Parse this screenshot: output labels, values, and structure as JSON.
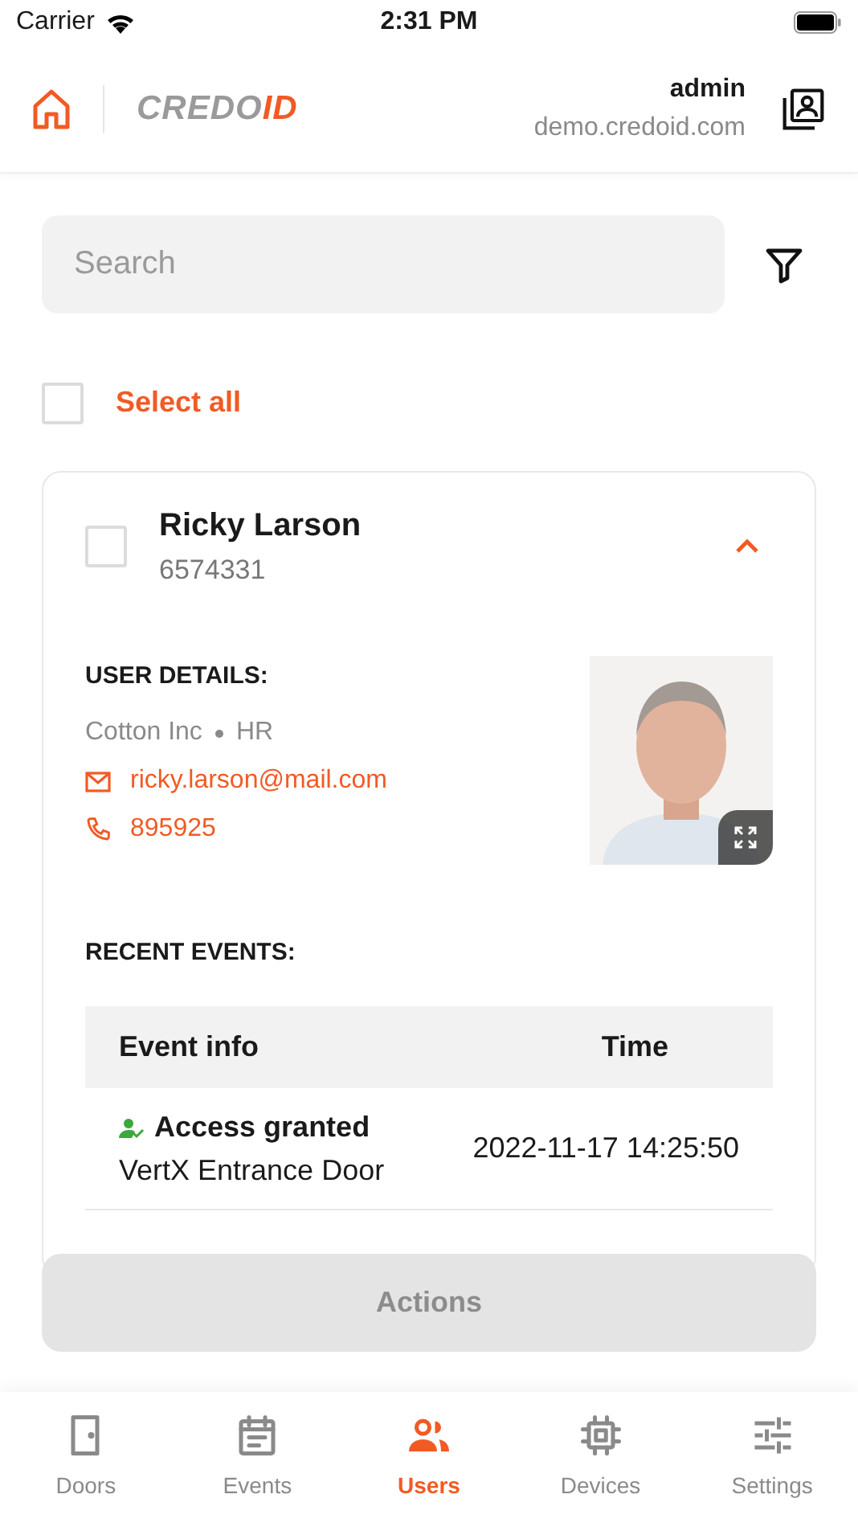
{
  "status_bar": {
    "carrier": "Carrier",
    "time": "2:31 PM"
  },
  "header": {
    "logo": {
      "grey": "CREDO",
      "accent": "ID"
    },
    "user": "admin",
    "domain": "demo.credoid.com"
  },
  "search": {
    "placeholder": "Search"
  },
  "select_all": {
    "label": "Select all",
    "checked": false
  },
  "user_card": {
    "name": "Ricky Larson",
    "number": "6574331",
    "checked": false,
    "expanded": true,
    "details_title": "USER DETAILS:",
    "company": "Cotton Inc",
    "department": "HR",
    "email": "ricky.larson@mail.com",
    "phone": "895925",
    "events_title": "RECENT EVENTS:",
    "columns": [
      "Event info",
      "Time"
    ],
    "events": [
      {
        "event": "Access granted",
        "door": "VertX Entrance Door",
        "time": "2022-11-17 14:25:50"
      }
    ]
  },
  "actions_button": {
    "label": "Actions",
    "disabled": true
  },
  "tabs": [
    {
      "label": "Doors",
      "selected": false
    },
    {
      "label": "Events",
      "selected": false
    },
    {
      "label": "Users",
      "selected": true
    },
    {
      "label": "Devices",
      "selected": false
    },
    {
      "label": "Settings",
      "selected": false
    }
  ]
}
